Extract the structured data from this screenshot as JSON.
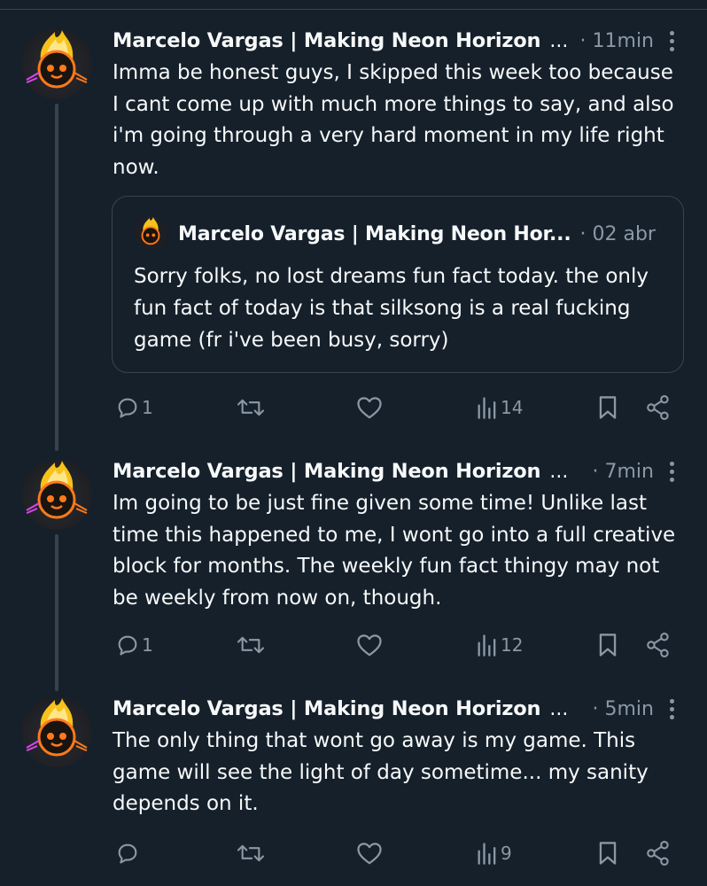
{
  "colors": {
    "background": "#15202b",
    "text": "#f7f9f9",
    "muted": "#8b98a5",
    "border": "#38444d"
  },
  "tweets": [
    {
      "author": "Marcelo Vargas | Making Neon Horizon",
      "ellipsis": "...",
      "time": "· 11min",
      "text_lines": [
        "Imma be honest guys, I skipped this week too because",
        "I cant come up with much more things to say, and also",
        "i'm going through a very hard moment in my life right",
        "now."
      ],
      "quote": {
        "author": "Marcelo Vargas | Making Neon Hor...",
        "time": "· 02 abr",
        "text_lines": [
          "Sorry folks, no lost dreams fun fact today. the only",
          "fun fact of today is that silksong is a real fucking",
          "game (fr i've been busy, sorry)"
        ]
      },
      "replies": "1",
      "views": "14"
    },
    {
      "author": "Marcelo Vargas | Making Neon Horizon",
      "ellipsis": "...",
      "time": "· 7min",
      "text_lines": [
        "Im going to be just fine given some time! Unlike last",
        "time this happened to me, I wont go into a full creative",
        "block for months. The weekly fun fact thingy may not",
        "be weekly from now on, though."
      ],
      "replies": "1",
      "views": "12"
    },
    {
      "author": "Marcelo Vargas | Making Neon Horizon",
      "ellipsis": "...",
      "time": "· 5min",
      "text_lines": [
        "The only thing that wont go away is my game. This",
        "game will see the light of day sometime... my sanity",
        "depends on it."
      ],
      "replies": "",
      "views": "9"
    }
  ],
  "icons": {
    "reply": "speech-bubble-icon",
    "retweet": "retweet-arrows-icon",
    "like": "heart-icon",
    "views": "bar-chart-icon",
    "bookmark": "bookmark-icon",
    "share": "share-nodes-icon",
    "more": "three-dots-vertical-icon"
  }
}
